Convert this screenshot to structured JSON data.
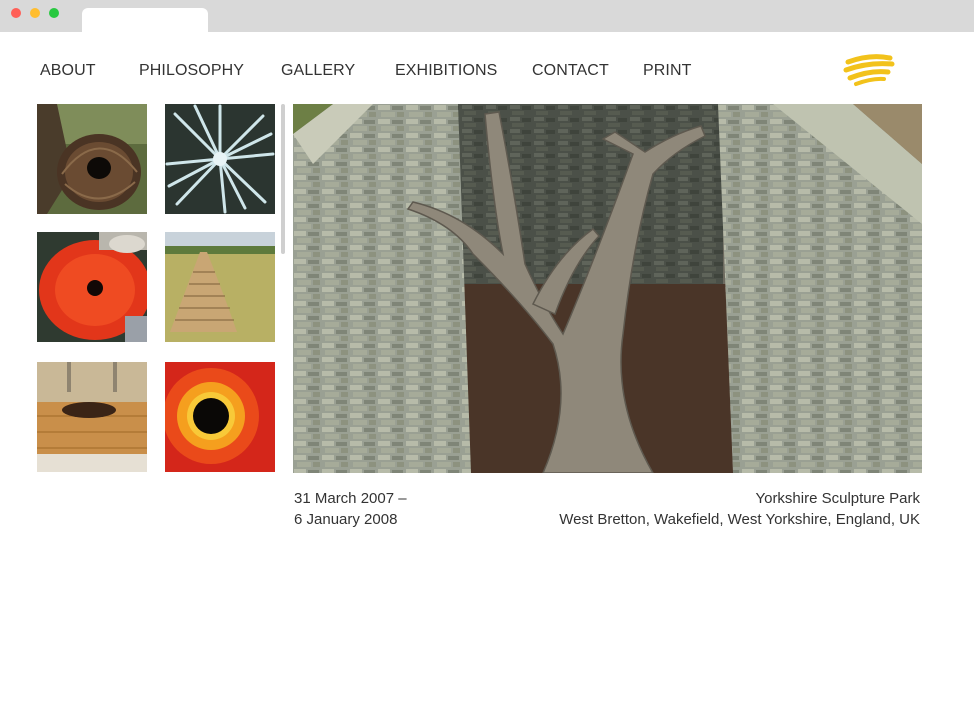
{
  "nav": {
    "about": "ABOUT",
    "philosophy": "PHILOSOPHY",
    "gallery": "GALLERY",
    "exhibitions": "EXHIBITIONS",
    "contact": "CONTACT",
    "print": "PRINT"
  },
  "thumbnails": [
    {
      "subject": "woven-branch-ring-in-tree"
    },
    {
      "subject": "ice-starburst"
    },
    {
      "subject": "red-leaves-with-hole"
    },
    {
      "subject": "stone-cairn-in-grass"
    },
    {
      "subject": "wooden-oval-installation"
    },
    {
      "subject": "orange-leaf-vortex"
    }
  ],
  "exhibition": {
    "date_start": "31 March 2007 –",
    "date_end": "6 January 2008",
    "venue": "Yorkshire Sculpture Park",
    "location": "West Bretton, Wakefield, West Yorkshire, England, UK"
  },
  "colors": {
    "logo": "#f2c21b",
    "text": "#333333",
    "chrome": "#d9d9d9"
  }
}
